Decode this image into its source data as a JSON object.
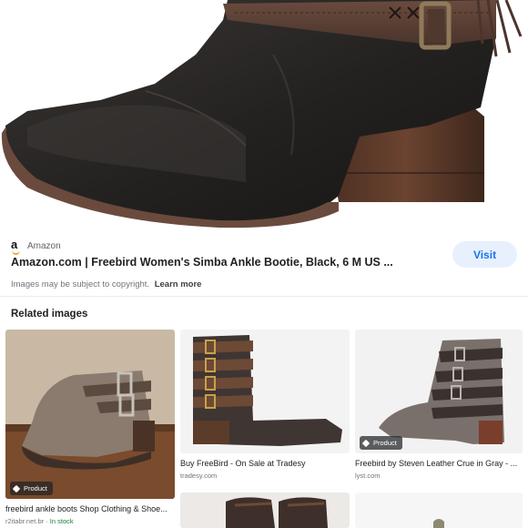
{
  "result": {
    "source_name": "Amazon",
    "source_logo_letter": "a",
    "title": "Amazon.com | Freebird Women's Simba Ankle Bootie, Black, 6 M US ...",
    "visit_label": "Visit",
    "copyright_text": "Images may be subject to copyright.",
    "learn_more_label": "Learn more"
  },
  "related": {
    "heading": "Related images",
    "items": [
      {
        "caption": "freebird ankle boots Shop Clothing & Shoe...",
        "site": "r2itabr.net.br",
        "stock": "In stock",
        "badge": "Product"
      },
      {
        "caption": "Buy FreeBird - On Sale at Tradesy",
        "site": "tradesy.com"
      },
      {
        "caption": "Freebird by Steven Leather Crue in Gray - ...",
        "site": "lyst.com",
        "badge": "Product"
      }
    ]
  },
  "colors": {
    "accent": "#1a73e8",
    "visit_bg": "#e8f0fe",
    "stock_green": "#188038"
  }
}
